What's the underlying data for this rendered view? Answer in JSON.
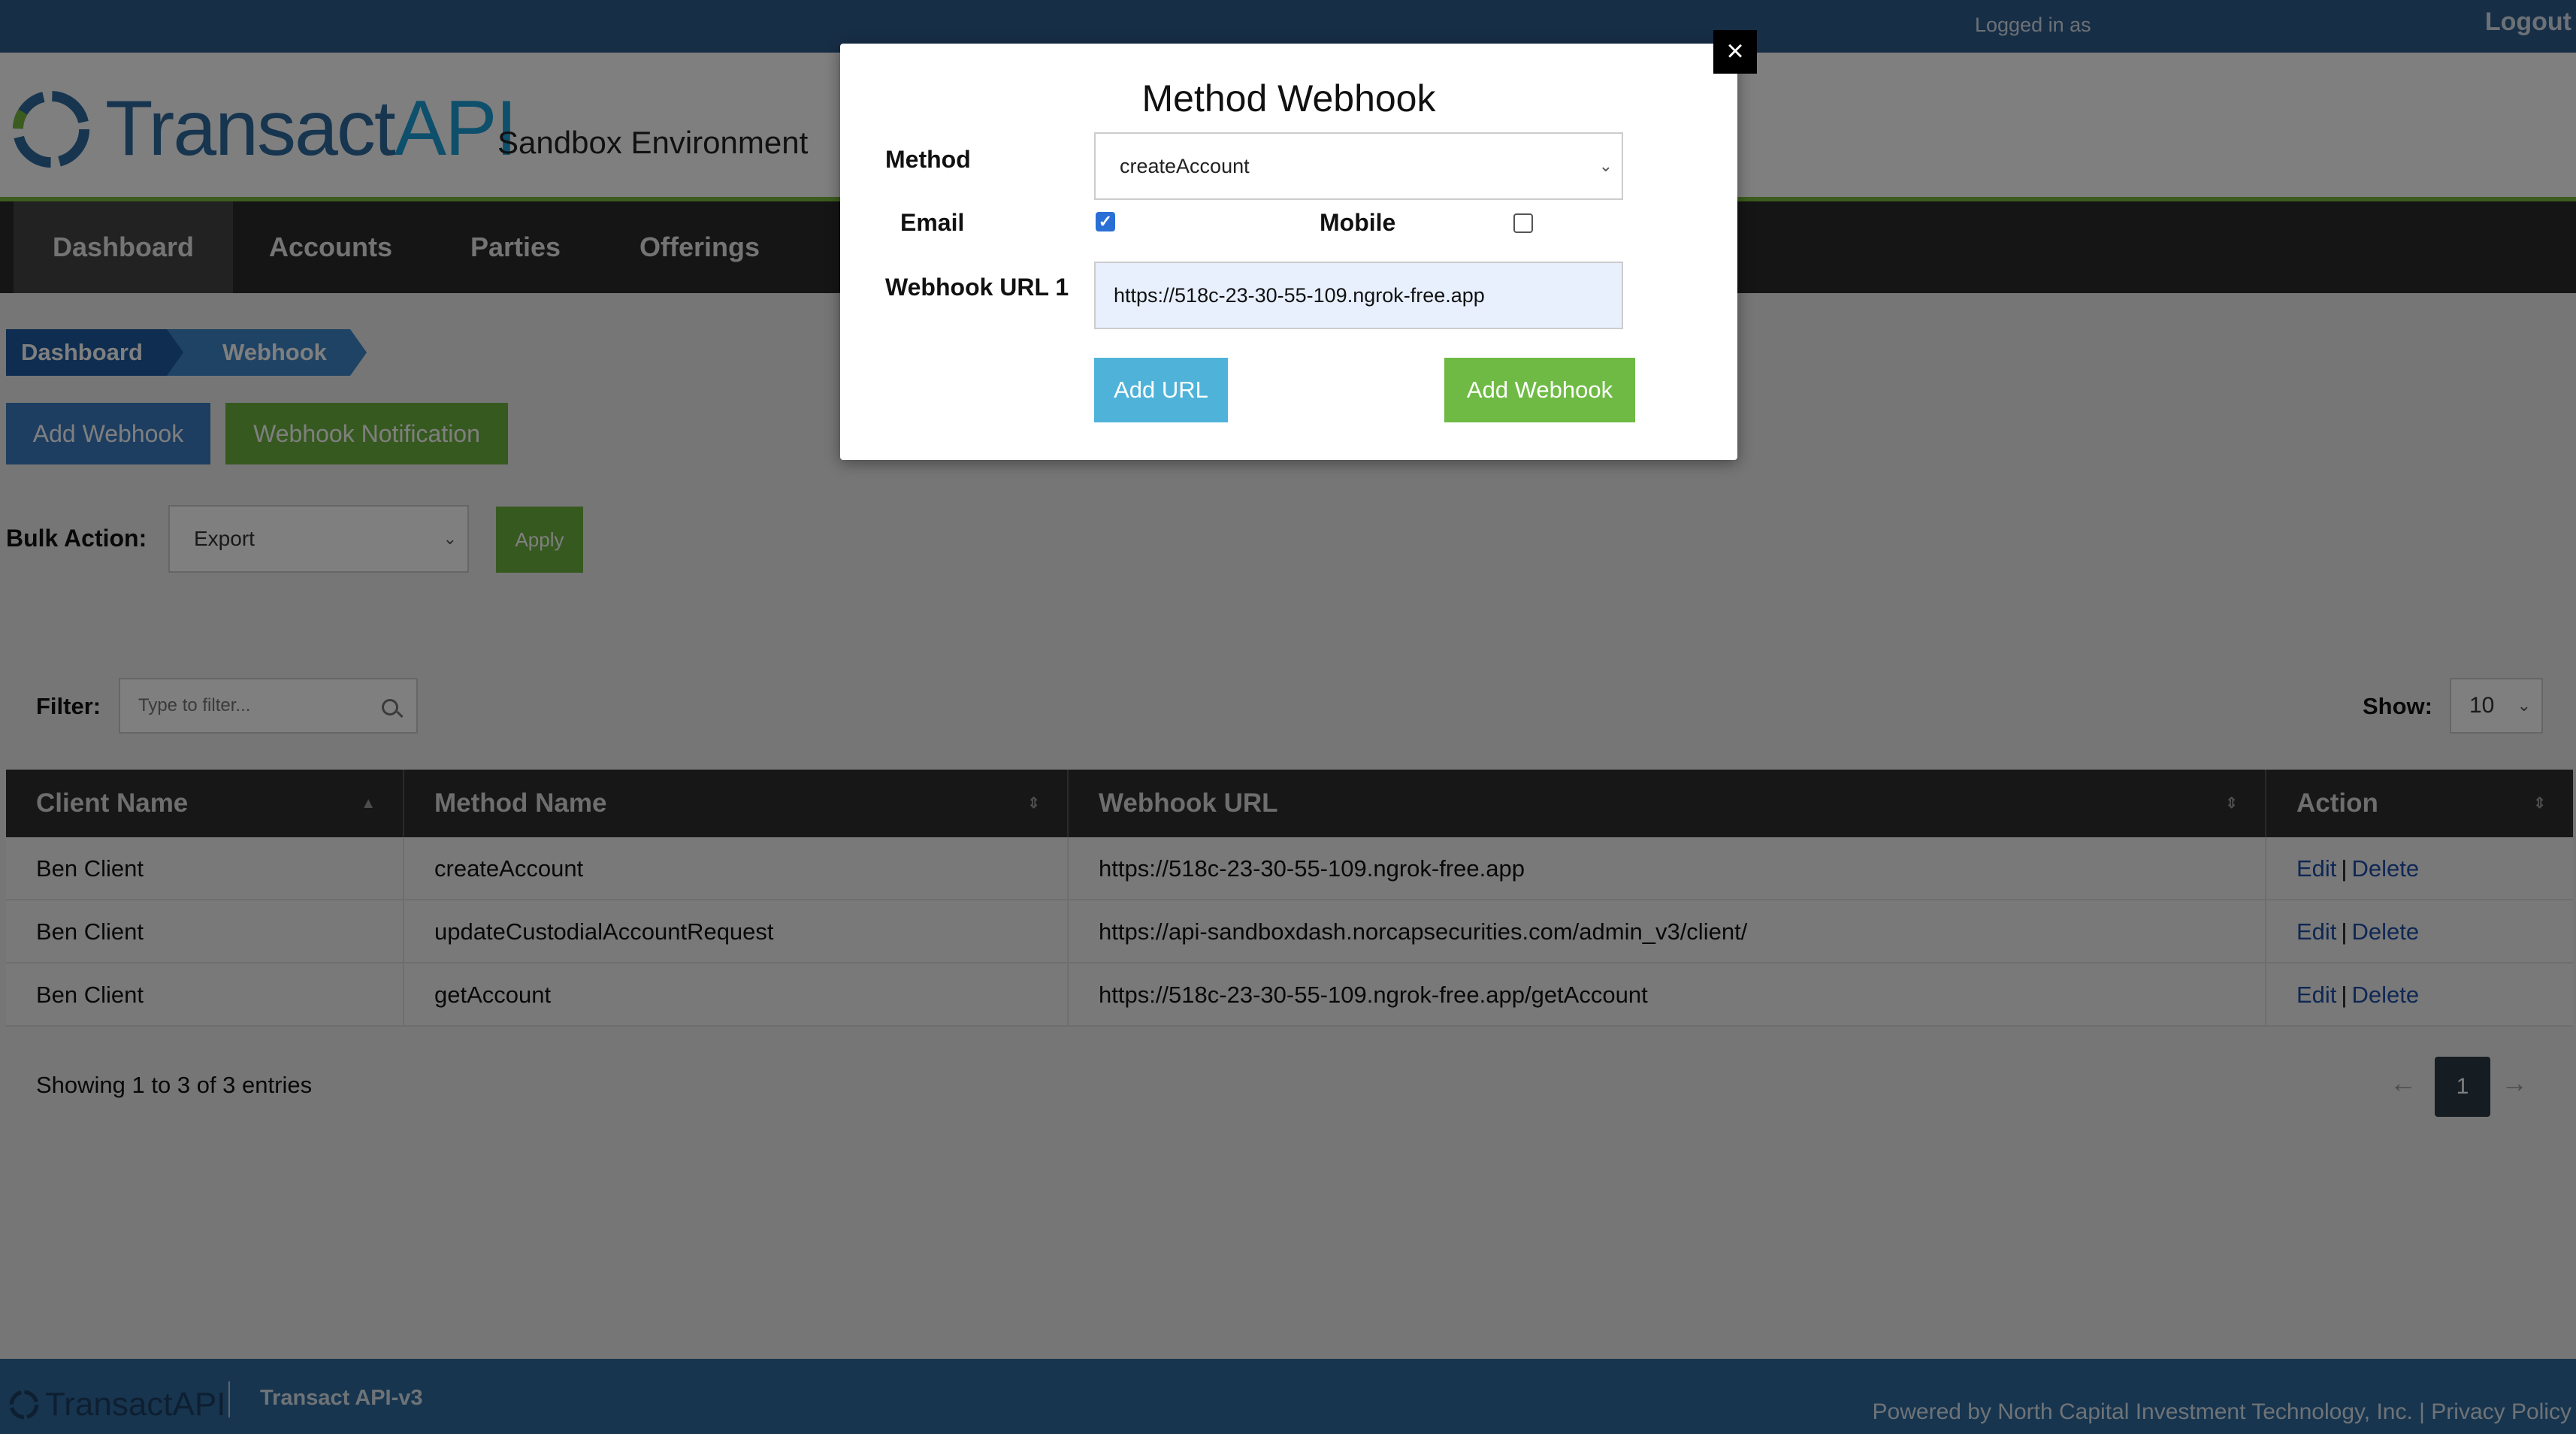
{
  "topbar": {
    "logged_in": "Logged in as",
    "logout": "Logout"
  },
  "header": {
    "logo_main": "Transact",
    "logo_accent": "API",
    "environment": "Sandbox Environment"
  },
  "nav": {
    "items": [
      "Dashboard",
      "Accounts",
      "Parties",
      "Offerings"
    ],
    "active": "Dashboard"
  },
  "breadcrumb": [
    "Dashboard",
    "Webhook"
  ],
  "actions": {
    "add_webhook": "Add Webhook",
    "webhook_notification": "Webhook Notification"
  },
  "bulk": {
    "label": "Bulk Action:",
    "selected": "Export",
    "apply": "Apply"
  },
  "filter": {
    "label": "Filter:",
    "placeholder": "Type to filter..."
  },
  "show": {
    "label": "Show:",
    "value": "10"
  },
  "table": {
    "columns": [
      "Client Name",
      "Method Name",
      "Webhook URL",
      "Action"
    ],
    "rows": [
      {
        "client": "Ben Client",
        "method": "createAccount",
        "url": "https://518c-23-30-55-109.ngrok-free.app",
        "edit": "Edit",
        "delete": "Delete"
      },
      {
        "client": "Ben Client",
        "method": "updateCustodialAccountRequest",
        "url": "https://api-sandboxdash.norcapsecurities.com/admin_v3/client/",
        "edit": "Edit",
        "delete": "Delete"
      },
      {
        "client": "Ben Client",
        "method": "getAccount",
        "url": "https://518c-23-30-55-109.ngrok-free.app/getAccount",
        "edit": "Edit",
        "delete": "Delete"
      }
    ]
  },
  "pagination": {
    "summary": "Showing 1 to 3 of 3 entries",
    "prev": "←",
    "current": "1",
    "next": "→"
  },
  "footer": {
    "logo": "TransactAPI",
    "version": "Transact API-v3",
    "powered": "Powered by North Capital Investment Technology, Inc. | Privacy Policy"
  },
  "modal": {
    "title": "Method Webhook",
    "method_label": "Method",
    "method_value": "createAccount",
    "email_label": "Email",
    "email_checked": true,
    "mobile_label": "Mobile",
    "mobile_checked": false,
    "url_label": "Webhook URL 1",
    "url_value": "https://518c-23-30-55-109.ngrok-free.app",
    "add_url": "Add URL",
    "add_webhook": "Add Webhook",
    "close": "×"
  },
  "colors": {
    "primary_blue": "#2e5d8e",
    "accent_green": "#6db33f",
    "nav_dark": "#2a2a2a",
    "link_blue": "#1c4fa8"
  }
}
